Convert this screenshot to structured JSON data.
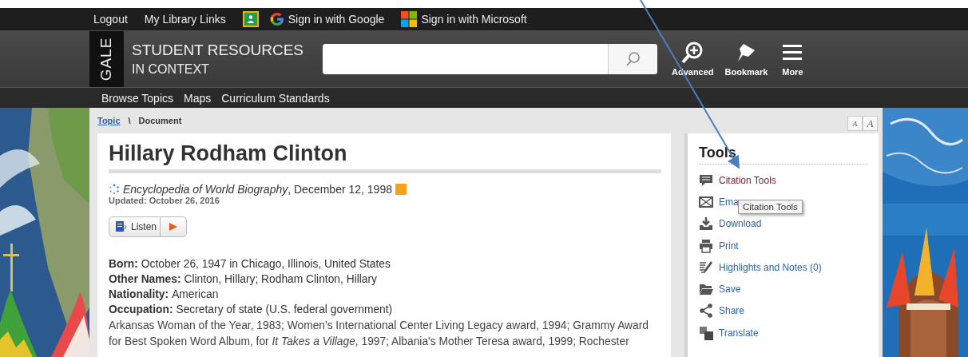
{
  "top_bar": {
    "links": [
      {
        "label": "Logout",
        "kind": "text"
      },
      {
        "label": "My Library Links",
        "kind": "text"
      },
      {
        "kind": "classroom"
      },
      {
        "label": "Sign in with Google",
        "kind": "google"
      },
      {
        "label": "Sign in with Microsoft",
        "kind": "microsoft"
      }
    ]
  },
  "header": {
    "logo": "GALE",
    "title_line_1": "STUDENT RESOURCES",
    "title_line_2": "IN CONTEXT",
    "actions": [
      {
        "label": "Advanced",
        "kind": "advanced"
      },
      {
        "label": "Bookmark",
        "kind": "bookmark"
      },
      {
        "label": "More",
        "kind": "more"
      }
    ]
  },
  "nav": {
    "items": [
      "Browse Topics",
      "Maps",
      "Curriculum Standards"
    ]
  },
  "breadcrumb": {
    "link": "Topic",
    "separator": "\\",
    "current": "Document"
  },
  "font_size_buttons": [
    "A",
    "A"
  ],
  "document": {
    "title": "Hillary Rodham Clinton",
    "source": "*Encyclopedia of World Biography*, December 12, 1998",
    "updated": "Updated: October 26, 2016",
    "listen": "Listen",
    "facts": [
      {
        "label": "Born:",
        "value": "October 26, 1947 in Chicago, Illinois, United States"
      },
      {
        "label": "Other Names:",
        "value": "Clinton, Hillary; Rodham Clinton, Hillary"
      },
      {
        "label": "Nationality:",
        "value": "American"
      },
      {
        "label": "Occupation:",
        "value": "Secretary of state (U.S. federal government)"
      }
    ],
    "paragraph": "Arkansas Woman of the Year, 1983; Women's International Center Living Legacy award, 1994; Grammy Award for Best Spoken Word Album, for *It Takes a Village*, 1997; Albania's Mother Teresa award, 1999; Rochester"
  },
  "tools": {
    "title": "Tools",
    "items": [
      {
        "label": "Citation Tools",
        "kind": "citation",
        "hovered": true
      },
      {
        "label": "Ema",
        "kind": "email",
        "hovered": false
      },
      {
        "label": "Download",
        "kind": "download",
        "hovered": false
      },
      {
        "label": "Print",
        "kind": "print",
        "hovered": false
      },
      {
        "label": "Highlights and Notes (0)",
        "kind": "highlights",
        "hovered": false
      },
      {
        "label": "Save",
        "kind": "save",
        "hovered": false
      },
      {
        "label": "Share",
        "kind": "share",
        "hovered": false
      },
      {
        "label": "Translate",
        "kind": "translate",
        "hovered": false
      }
    ],
    "tooltip": "Citation Tools"
  }
}
